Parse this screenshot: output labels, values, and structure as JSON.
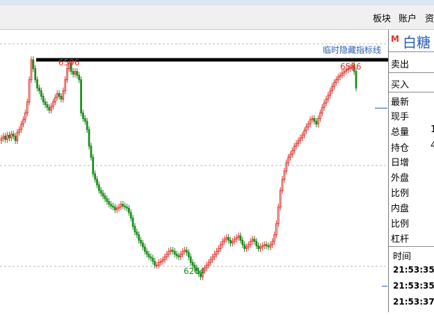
{
  "menu": [
    "板块",
    "账户",
    "资"
  ],
  "toggle_link": "临时隐藏指标线",
  "chart_data": {
    "type": "candlestick",
    "y_range": [
      6140,
      6650
    ],
    "annotations": {
      "high_left": "6596",
      "high_right": "6586",
      "low": "6204"
    },
    "resistance_level": 6596,
    "closes": [
      6454,
      6458,
      6452,
      6460,
      6455,
      6462,
      6458,
      6450,
      6465,
      6470,
      6480,
      6488,
      6500,
      6520,
      6560,
      6596,
      6580,
      6560,
      6545,
      6540,
      6530,
      6520,
      6515,
      6510,
      6505,
      6512,
      6520,
      6528,
      6535,
      6530,
      6525,
      6540,
      6560,
      6580,
      6590,
      6575,
      6570,
      6575,
      6568,
      6560,
      6500,
      6490,
      6485,
      6470,
      6440,
      6420,
      6390,
      6380,
      6370,
      6360,
      6355,
      6350,
      6345,
      6340,
      6335,
      6332,
      6330,
      6325,
      6328,
      6330,
      6335,
      6332,
      6330,
      6328,
      6320,
      6310,
      6295,
      6285,
      6280,
      6270,
      6265,
      6258,
      6250,
      6245,
      6240,
      6238,
      6232,
      6225,
      6225,
      6230,
      6232,
      6235,
      6240,
      6245,
      6250,
      6252,
      6250,
      6245,
      6242,
      6240,
      6245,
      6250,
      6252,
      6248,
      6240,
      6230,
      6225,
      6220,
      6215,
      6210,
      6204,
      6215,
      6220,
      6225,
      6230,
      6235,
      6240,
      6245,
      6250,
      6255,
      6262,
      6268,
      6272,
      6275,
      6270,
      6265,
      6268,
      6272,
      6275,
      6278,
      6270,
      6262,
      6255,
      6258,
      6262,
      6268,
      6272,
      6268,
      6260,
      6255,
      6258,
      6260,
      6262,
      6260,
      6258,
      6262,
      6268,
      6280,
      6300,
      6330,
      6360,
      6380,
      6395,
      6410,
      6420,
      6425,
      6432,
      6440,
      6445,
      6450,
      6455,
      6460,
      6468,
      6475,
      6480,
      6488,
      6490,
      6485,
      6480,
      6490,
      6500,
      6510,
      6518,
      6525,
      6532,
      6540,
      6548,
      6555,
      6560,
      6565,
      6568,
      6572,
      6575,
      6578,
      6580,
      6582,
      6586,
      6575,
      6545
    ]
  },
  "panel": {
    "badge": "M",
    "instrument": "白糖",
    "sell": "卖出",
    "buy": "买入",
    "latest": "最新",
    "current_hand": "现手",
    "total_volume": "总量",
    "total_volume_value": "1",
    "open_interest": "持仓",
    "open_interest_value": "4",
    "daily_increase": "日增",
    "outer_disk": "外盘",
    "ratio1": "比例",
    "inner_disk": "内盘",
    "ratio2": "比例",
    "leverage": "杠杆",
    "time_header": "时间",
    "times": [
      "21:53:35",
      "21:53:35",
      "21:53:37"
    ]
  },
  "colors": {
    "up": "#e0302a",
    "down": "#1a8a1a",
    "line": "#000000",
    "link": "#2a5db0",
    "grid": "#b8b8b8"
  }
}
